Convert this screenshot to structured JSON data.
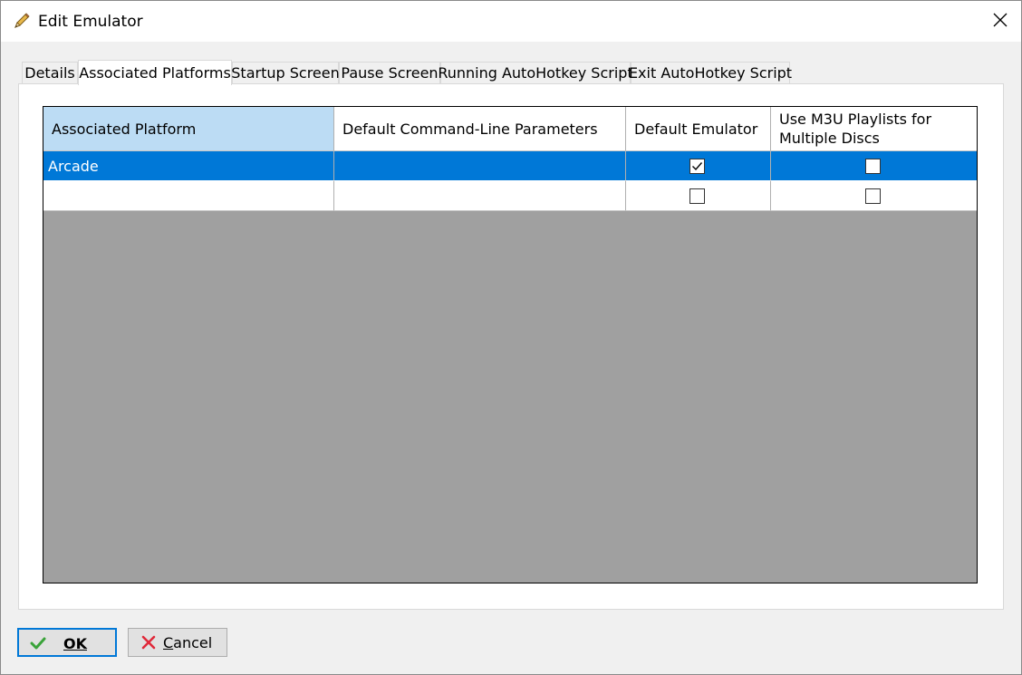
{
  "window": {
    "title": "Edit Emulator",
    "title_icon": "pencil-icon",
    "close_icon": "close-icon"
  },
  "tabs": [
    {
      "label": "Details",
      "active": false
    },
    {
      "label": "Associated Platforms",
      "active": true
    },
    {
      "label": "Startup Screen",
      "active": false
    },
    {
      "label": "Pause Screen",
      "active": false
    },
    {
      "label": "Running AutoHotkey Script",
      "active": false
    },
    {
      "label": "Exit AutoHotkey Script",
      "active": false
    }
  ],
  "grid": {
    "columns": [
      "Associated Platform",
      "Default Command-Line Parameters",
      "Default Emulator",
      "Use M3U Playlists for Multiple Discs"
    ],
    "rows": [
      {
        "platform": "Arcade",
        "parameters": "",
        "default_emulator": true,
        "use_m3u": false,
        "selected": true
      },
      {
        "platform": "",
        "parameters": "",
        "default_emulator": false,
        "use_m3u": false,
        "selected": false
      }
    ]
  },
  "buttons": {
    "ok_label": "OK",
    "ok_icon": "check-icon",
    "cancel_label": "Cancel",
    "cancel_icon": "x-icon"
  },
  "colors": {
    "selection": "#0078d7",
    "sorted_header": "#bcdcf4",
    "empty_grid": "#a0a0a0",
    "ok_check": "#3aa33a",
    "cancel_x": "#e0293a"
  }
}
